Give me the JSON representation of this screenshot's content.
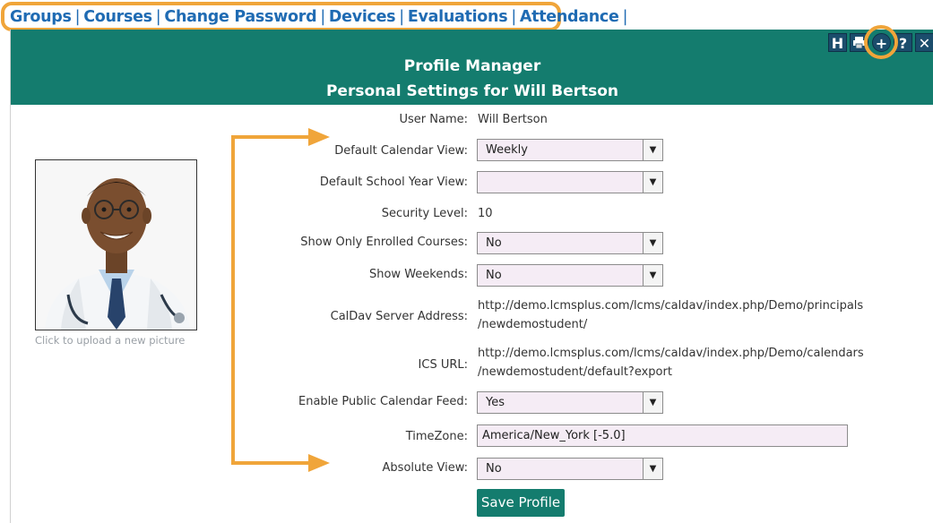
{
  "nav": {
    "links": [
      "Groups",
      "Courses",
      "Change Password",
      "Devices",
      "Evaluations",
      "Attendance"
    ],
    "separator": "|"
  },
  "toolbar": {
    "h_label": "H",
    "print_icon": "printer-icon",
    "add_label": "+",
    "help_label": "?",
    "close_label": "✕"
  },
  "header": {
    "title": "Profile Manager",
    "subtitle": "Personal Settings for Will Bertson"
  },
  "profile": {
    "upload_hint": "Click to upload a new picture"
  },
  "form": {
    "user_name_label": "User Name:",
    "user_name_value": "Will Bertson",
    "calendar_view_label": "Default Calendar View:",
    "calendar_view_value": "Weekly",
    "school_year_label": "Default School Year View:",
    "school_year_value": "",
    "security_label": "Security Level:",
    "security_value": "10",
    "enrolled_label": "Show Only Enrolled Courses:",
    "enrolled_value": "No",
    "weekends_label": "Show Weekends:",
    "weekends_value": "No",
    "caldav_label": "CalDav Server Address:",
    "caldav_line1": "http://demo.lcmsplus.com/lcms/caldav/index.php/Demo/principals",
    "caldav_line2": "/newdemostudent/",
    "ics_label": "ICS URL:",
    "ics_line1": "http://demo.lcmsplus.com/lcms/caldav/index.php/Demo/calendars",
    "ics_line2": "/newdemostudent/default?export",
    "public_feed_label": "Enable Public Calendar Feed:",
    "public_feed_value": "Yes",
    "timezone_label": "TimeZone:",
    "timezone_value": "America/New_York [-5.0]",
    "absolute_label": "Absolute View:",
    "absolute_value": "No",
    "save_label": "Save Profile"
  },
  "colors": {
    "header_bg": "#147c6e",
    "nav_link": "#1f6bb3",
    "highlight": "#f0a53a",
    "select_bg": "#f5ecf5"
  }
}
